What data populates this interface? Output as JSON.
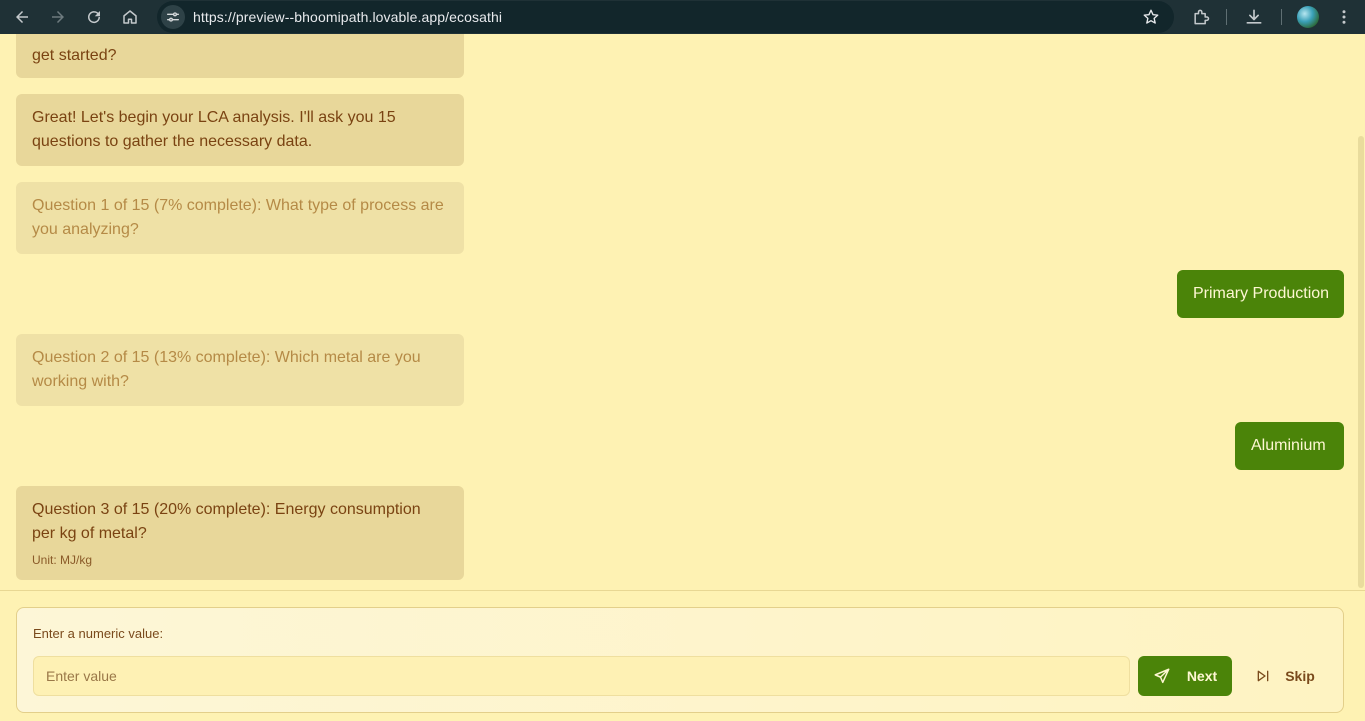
{
  "browser": {
    "url": "https://preview--bhoomipath.lovable.app/ecosathi",
    "icons": [
      "back-arrow-icon",
      "forward-arrow-icon",
      "reload-icon",
      "home-icon",
      "site-info-icon",
      "bookmark-star-icon",
      "extensions-icon",
      "download-icon",
      "profile-avatar-icon",
      "more-menu-icon"
    ]
  },
  "chat": {
    "partial_message": "get started?",
    "bot_intro": "Great! Let's begin your LCA analysis. I'll ask you 15 questions to gather the necessary data.",
    "question1": "Question 1 of 15 (7% complete): What type of process are you analyzing?",
    "answer1": "Primary Production",
    "question2": "Question 2 of 15 (13% complete): Which metal are you working with?",
    "answer2": "Aluminium",
    "question3": "Question 3 of 15 (20% complete): Energy consumption per kg of metal?",
    "question3_unit": "Unit: MJ/kg"
  },
  "input_panel": {
    "label": "Enter a numeric value:",
    "placeholder": "Enter value",
    "value": "",
    "next_label": "Next",
    "skip_label": "Skip"
  },
  "colors": {
    "background": "#fef2b3",
    "bot_bubble": "#e8d79a",
    "user_bubble": "#4b8409",
    "text": "#7a4312"
  }
}
